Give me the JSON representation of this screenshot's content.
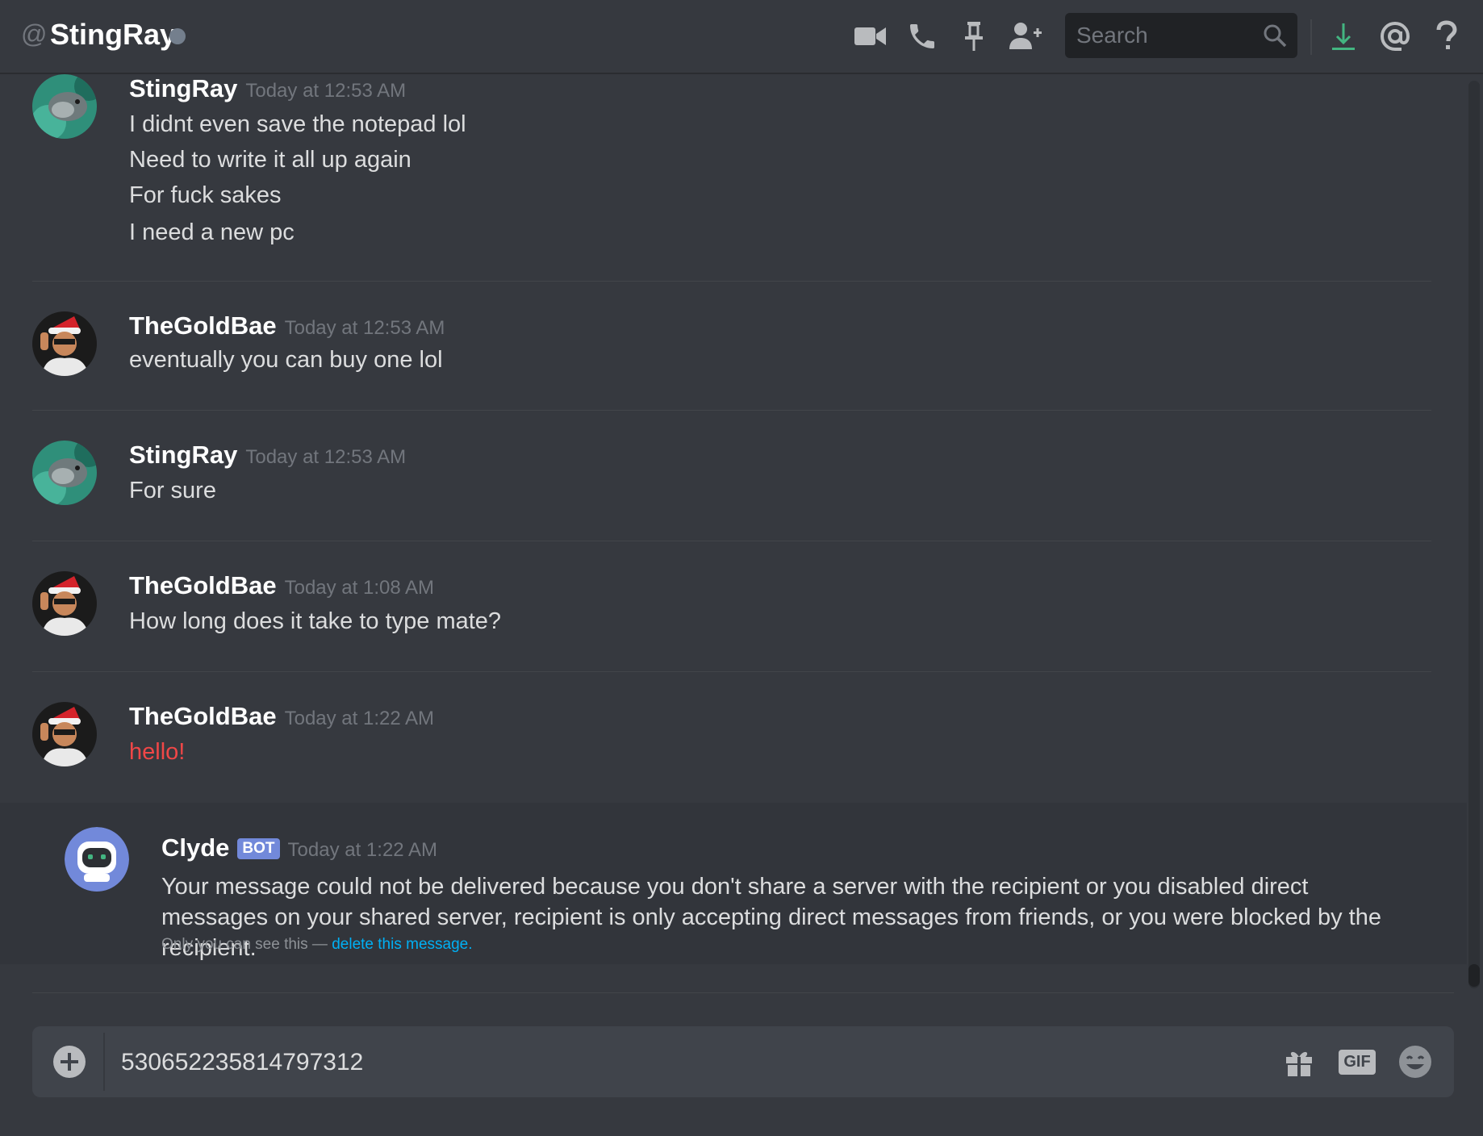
{
  "header": {
    "at_symbol": "@",
    "title": "StingRay",
    "search_placeholder": "Search",
    "icons": [
      "video-call-icon",
      "voice-call-icon",
      "pin-icon",
      "add-friend-icon",
      "search-icon",
      "download-icon",
      "mention-icon",
      "help-icon"
    ]
  },
  "messages": [
    {
      "author": "StingRay",
      "timestamp": "Today at 12:53 AM",
      "lines": [
        "I didnt even save the notepad lol",
        "Need to write it all up again",
        "For fuck sakes",
        "I need a new pc"
      ]
    },
    {
      "author": "TheGoldBae",
      "timestamp": "Today at 12:53 AM",
      "lines": [
        "eventually you can buy one lol"
      ]
    },
    {
      "author": "StingRay",
      "timestamp": "Today at 12:53 AM",
      "lines": [
        "For sure"
      ]
    },
    {
      "author": "TheGoldBae",
      "timestamp": "Today at 1:08 AM",
      "lines": [
        "How long does it take to type mate?"
      ]
    },
    {
      "author": "TheGoldBae",
      "timestamp": "Today at 1:22 AM",
      "lines": [
        "hello!"
      ]
    }
  ],
  "clyde": {
    "author": "Clyde",
    "tag": "BOT",
    "timestamp": "Today at 1:22 AM",
    "text": "Your message could not be delivered because you don't share a server with the recipient or you disabled direct messages on your shared server, recipient is only accepting direct messages from friends, or you were blocked by the recipient.",
    "ephemeral_prefix": "Only you can see this — ",
    "ephemeral_link": "delete this message",
    "ephemeral_suffix": "."
  },
  "composer": {
    "value": "530652235814797312",
    "gif_label": "GIF"
  },
  "colors": {
    "background": "#36393f",
    "error_text": "#f04747",
    "link": "#00b0f4",
    "bot_tag": "#7289da",
    "download_accent": "#43b581"
  }
}
